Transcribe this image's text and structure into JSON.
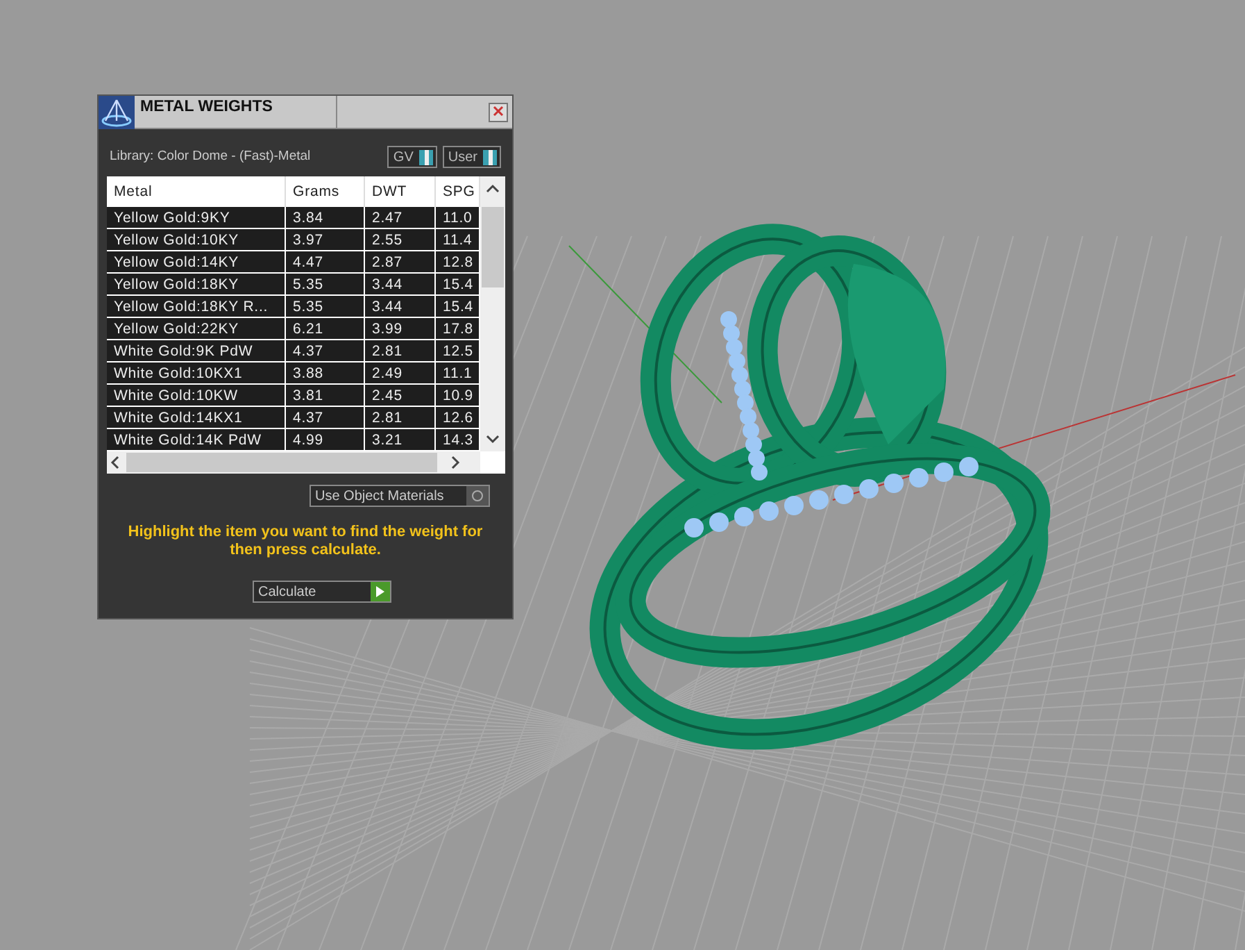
{
  "window": {
    "title": "METAL WEIGHTS"
  },
  "library": {
    "label": "Library: Color Dome - (Fast)-Metal"
  },
  "toggles": [
    {
      "label": "GV",
      "on": true
    },
    {
      "label": "User",
      "on": true
    }
  ],
  "table": {
    "columns": [
      "Metal",
      "Grams",
      "DWT",
      "SPG"
    ],
    "rows": [
      [
        "Yellow Gold:9KY",
        "3.84",
        "2.47",
        "11.0"
      ],
      [
        "Yellow Gold:10KY",
        "3.97",
        "2.55",
        "11.4"
      ],
      [
        "Yellow Gold:14KY",
        "4.47",
        "2.87",
        "12.8"
      ],
      [
        "Yellow Gold:18KY",
        "5.35",
        "3.44",
        "15.4"
      ],
      [
        "Yellow Gold:18KY R...",
        "5.35",
        "3.44",
        "15.4"
      ],
      [
        "Yellow Gold:22KY",
        "6.21",
        "3.99",
        "17.8"
      ],
      [
        "White Gold:9K PdW",
        "4.37",
        "2.81",
        "12.5"
      ],
      [
        "White Gold:10KX1",
        "3.88",
        "2.49",
        "11.1"
      ],
      [
        "White Gold:10KW",
        "3.81",
        "2.45",
        "10.9"
      ],
      [
        "White Gold:14KX1",
        "4.37",
        "2.81",
        "12.6"
      ],
      [
        "White Gold:14K PdW",
        "4.99",
        "3.21",
        "14.3"
      ]
    ]
  },
  "use_object_materials": {
    "label": "Use Object Materials",
    "on": false
  },
  "hint": "Highlight the item you want to find the weight for then press calculate.",
  "calculate_button": {
    "label": "Calculate"
  }
}
